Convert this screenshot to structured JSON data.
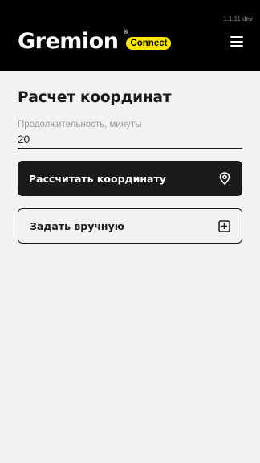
{
  "header": {
    "version": "1.1.11 dev",
    "logo_text": "Gremion",
    "logo_mark": "®",
    "badge": "Connect",
    "menu_icon": "hamburger-menu-icon"
  },
  "main": {
    "title": "Расчет координат",
    "duration_field": {
      "label": "Продолжительность, минуты",
      "value": "20"
    },
    "calculate_button": {
      "label": "Рассчитать координату",
      "icon": "location-pin-icon"
    },
    "manual_button": {
      "label": "Задать вручную",
      "icon": "plus-square-icon"
    }
  },
  "colors": {
    "header_bg": "#000000",
    "badge": "#ffe600",
    "page_bg": "#f2f2f2",
    "dark_button": "#1b1b1b"
  }
}
